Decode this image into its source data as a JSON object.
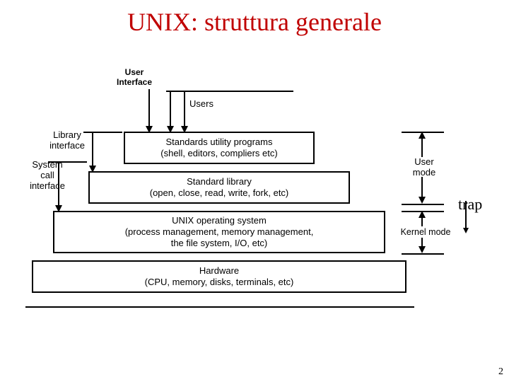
{
  "title": "UNIX: struttura generale",
  "labels": {
    "user_interface": "User\nInterface",
    "users": "Users",
    "library_interface": "Library\ninterface",
    "system_call_interface": "System\ncall\ninterface",
    "user_mode": "User\nmode",
    "kernel_mode": "Kernel mode"
  },
  "layers": {
    "utils": {
      "name": "Standards utility programs",
      "sub": "(shell, editors, compliers etc)"
    },
    "stdlib": {
      "name": "Standard library",
      "sub": "(open, close, read, write, fork, etc)"
    },
    "os": {
      "name": "UNIX operating system",
      "sub": "(process management, memory management,\nthe file system, I/O, etc)"
    },
    "hw": {
      "name": "Hardware",
      "sub": "(CPU, memory, disks, terminals, etc)"
    }
  },
  "annotations": {
    "trap": "trap"
  },
  "page_number": "2"
}
